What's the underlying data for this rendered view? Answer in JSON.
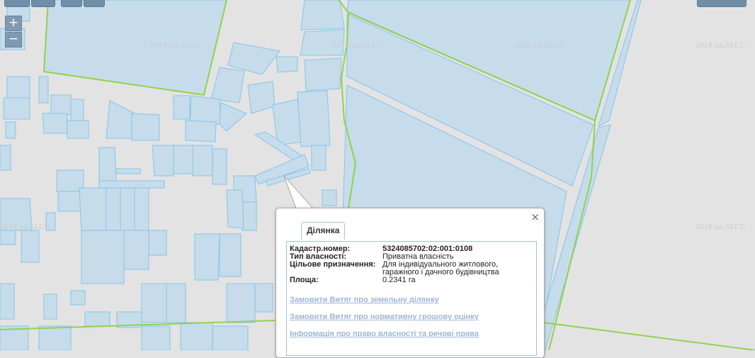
{
  "watermark": "2018.ua.SLCC",
  "zoom": {
    "in_label": "+",
    "out_label": "−"
  },
  "popup": {
    "close_label": "×",
    "tab_label": "Ділянка",
    "fields": [
      {
        "key": "Кадастр.номер:",
        "value": "5324085702:02:001:0108"
      },
      {
        "key": "Тип власності:",
        "value": "Приватна власність"
      },
      {
        "key": "Цільове призначення:",
        "value": "Для індивідуального житлового, гаражного і дачного будівництва"
      },
      {
        "key": "Площа:",
        "value": "0.2341 га"
      }
    ],
    "links": [
      "Замовити Витяг про земельну ділянку",
      "Замовити Витяг про нормативну грошову оцінку",
      "Інформація про право власності та речові права"
    ]
  },
  "colors": {
    "background": "#e3e3e3",
    "parcel_fill": "#c6dceb",
    "parcel_stroke": "#86c3ea",
    "boundary": "#8fd34b",
    "link": "#9cb7d6"
  }
}
